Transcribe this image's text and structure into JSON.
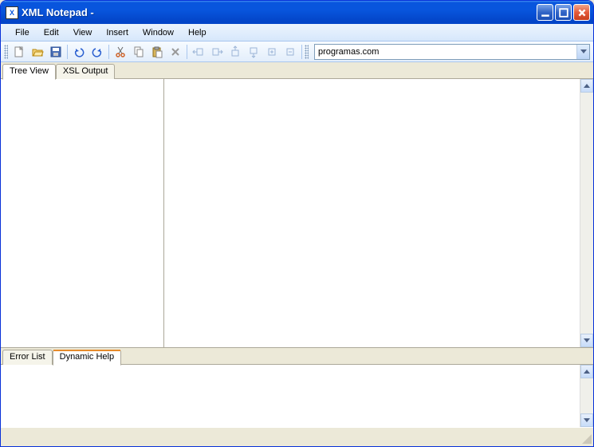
{
  "window": {
    "title": "XML Notepad -"
  },
  "menu": {
    "file": "File",
    "edit": "Edit",
    "view": "View",
    "insert": "Insert",
    "window": "Window",
    "help": "Help"
  },
  "toolbar": {
    "url_value": "programas.com"
  },
  "topTabs": {
    "tree": "Tree View",
    "xsl": "XSL Output"
  },
  "bottomTabs": {
    "errors": "Error List",
    "help": "Dynamic Help"
  },
  "icons": {
    "new": "new",
    "open": "open",
    "save": "save",
    "undo": "undo",
    "redo": "redo",
    "cut": "cut",
    "copy": "copy",
    "paste": "paste",
    "delete": "delete",
    "nudge_left": "nudge-left",
    "nudge_right": "nudge-right",
    "nudge_up": "nudge-up",
    "nudge_down": "nudge-down",
    "expand": "expand",
    "collapse": "collapse"
  }
}
